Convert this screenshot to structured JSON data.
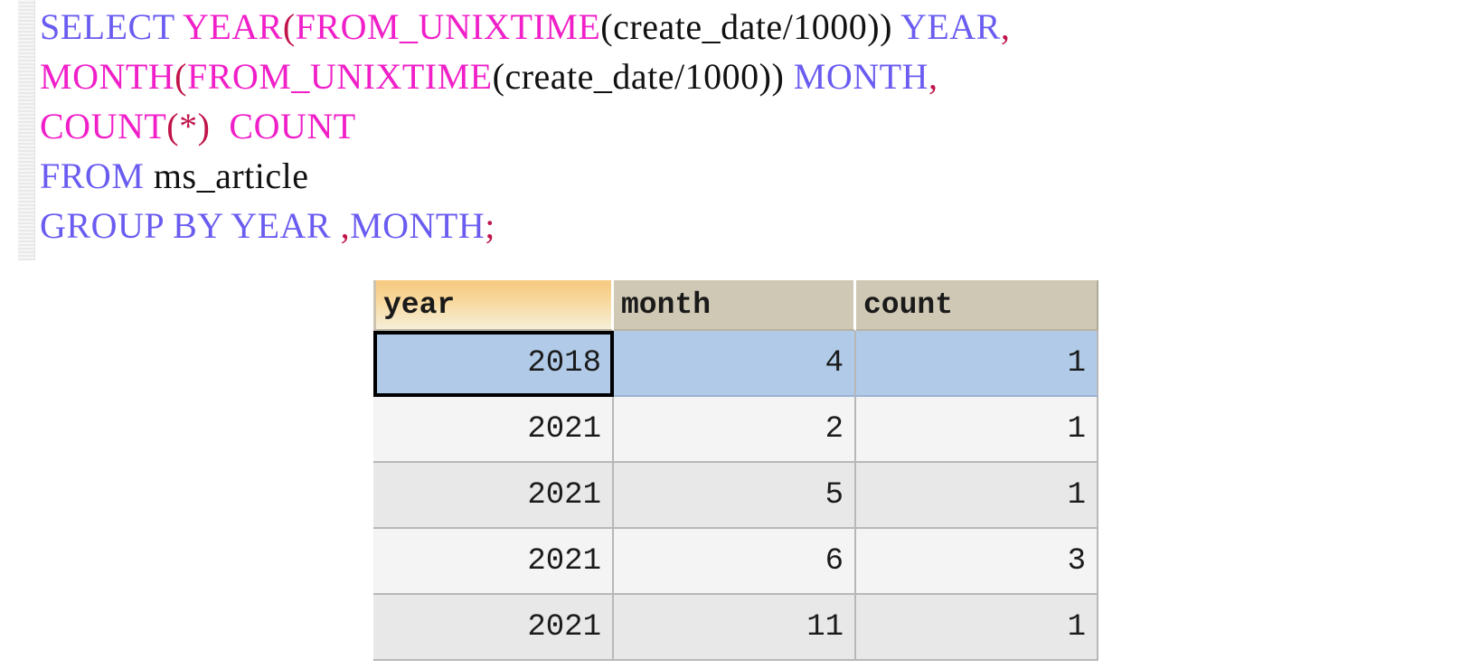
{
  "editor": {
    "name": "sql-query-editor",
    "language": "sql",
    "lines": [
      {
        "tokens": [
          {
            "t": "SELECT",
            "c": "kw"
          },
          {
            "t": " ",
            "c": "pln"
          },
          {
            "t": "YEAR",
            "c": "fn"
          },
          {
            "t": "(",
            "c": "pun"
          },
          {
            "t": "FROM_UNIXTIME",
            "c": "fn"
          },
          {
            "t": "(create_date/1000))",
            "c": "pln"
          },
          {
            "t": " ",
            "c": "pln"
          },
          {
            "t": "YEAR",
            "c": "kw"
          },
          {
            "t": ",",
            "c": "pun"
          }
        ]
      },
      {
        "tokens": [
          {
            "t": "MONTH",
            "c": "fn"
          },
          {
            "t": "(",
            "c": "pun"
          },
          {
            "t": "FROM_UNIXTIME",
            "c": "fn"
          },
          {
            "t": "(create_date/1000))",
            "c": "pln"
          },
          {
            "t": " ",
            "c": "pln"
          },
          {
            "t": "MONTH",
            "c": "kw"
          },
          {
            "t": ",",
            "c": "pun"
          }
        ]
      },
      {
        "tokens": [
          {
            "t": "COUNT",
            "c": "fn"
          },
          {
            "t": "(*)",
            "c": "pun"
          },
          {
            "t": "  ",
            "c": "pln"
          },
          {
            "t": "COUNT",
            "c": "fn"
          }
        ]
      },
      {
        "tokens": [
          {
            "t": "FROM",
            "c": "kw"
          },
          {
            "t": " ",
            "c": "pln"
          },
          {
            "t": "ms_article",
            "c": "pln"
          }
        ]
      },
      {
        "tokens": [
          {
            "t": "GROUP BY YEAR ",
            "c": "kw"
          },
          {
            "t": ",",
            "c": "pun"
          },
          {
            "t": "MONTH",
            "c": "kw"
          },
          {
            "t": ";",
            "c": "pun"
          }
        ]
      }
    ],
    "plain_text": "SELECT YEAR(FROM_UNIXTIME(create_date/1000)) YEAR,\nMONTH(FROM_UNIXTIME(create_date/1000)) MONTH,\nCOUNT(*)  COUNT\nFROM ms_article\nGROUP BY YEAR ,MONTH;"
  },
  "result_grid": {
    "columns": [
      {
        "label": "year",
        "active": true
      },
      {
        "label": "month",
        "active": false
      },
      {
        "label": "count",
        "active": false
      }
    ],
    "rows": [
      {
        "year": "2018",
        "month": "4",
        "count": "1",
        "selected": true
      },
      {
        "year": "2021",
        "month": "2",
        "count": "1",
        "selected": false
      },
      {
        "year": "2021",
        "month": "5",
        "count": "1",
        "selected": false
      },
      {
        "year": "2021",
        "month": "6",
        "count": "3",
        "selected": false
      },
      {
        "year": "2021",
        "month": "11",
        "count": "1",
        "selected": false
      }
    ],
    "selected_row_index": 0,
    "focused_cell": {
      "row": 0,
      "column": "year",
      "value": "2018"
    }
  },
  "colors": {
    "keyword": "#6a5cf0",
    "function": "#f01fc8",
    "plain": "#111111",
    "punctuation": "#c0144a",
    "header_active_start": "#f6c97f",
    "header_active_end": "#f5efd9",
    "header_inactive": "#cfc8b4",
    "row_selected": "#b0cae8",
    "row_odd": "#f4f4f4",
    "row_even": "#e8e8e8",
    "page_background": "#ffffff"
  }
}
